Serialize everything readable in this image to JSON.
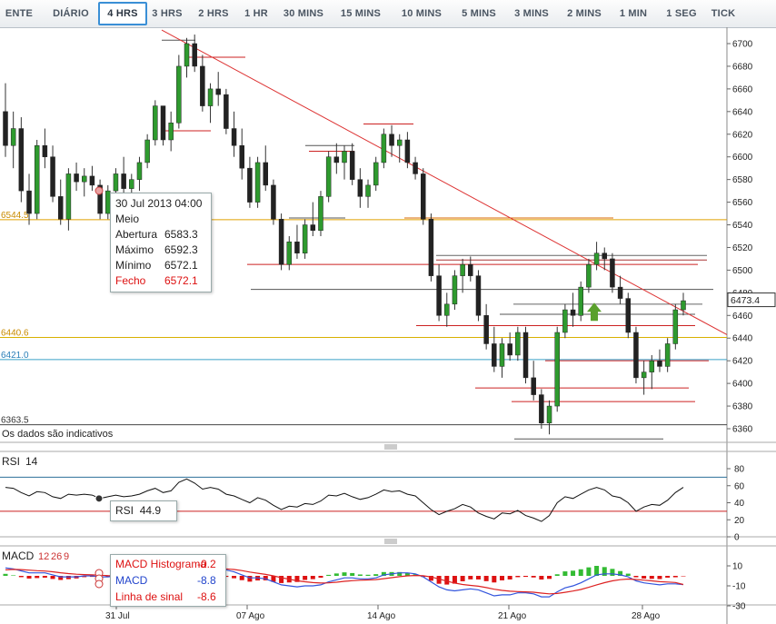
{
  "timeframes": [
    "ENTE",
    "DIÁRIO",
    "4 HRS",
    "3 HRS",
    "2 HRS",
    "1 HR",
    "30 MINS",
    "15 MINS",
    "10 MINS",
    "5 MINS",
    "3 MINS",
    "2 MINS",
    "1 MIN",
    "1 SEG",
    "TICK"
  ],
  "active_timeframe": "4 HRS",
  "disclaimer": "Os dados são indicativos",
  "price_axis": {
    "ticks": [
      6700,
      6680,
      6660,
      6640,
      6620,
      6600,
      6580,
      6560,
      6540,
      6520,
      6500,
      6480,
      6460,
      6440,
      6420,
      6400,
      6380,
      6360
    ],
    "current_price": "6473.4"
  },
  "level_labels": [
    {
      "text": "6544.5",
      "value": 6544.5,
      "color": "#c98b00"
    },
    {
      "text": "6440.6",
      "value": 6440.6,
      "color": "#c98b00"
    },
    {
      "text": "6421.0",
      "value": 6421.0,
      "color": "#2a7fb8"
    },
    {
      "text": "6363.5",
      "value": 6363.5,
      "color": "#333333"
    }
  ],
  "x_labels": [
    "31 Jul",
    "07 Ago",
    "14 Ago",
    "21 Ago",
    "28 Ago"
  ],
  "tooltip": {
    "date": "30 Jul 2013 04:00",
    "sub": "Meio",
    "rows": [
      {
        "label": "Abertura",
        "value": "6583.3"
      },
      {
        "label": "Máximo",
        "value": "6592.3"
      },
      {
        "label": "Mínimo",
        "value": "6572.1"
      },
      {
        "label": "Fecho",
        "value": "6572.1"
      }
    ]
  },
  "rsi": {
    "title": "RSI",
    "period": "14",
    "label": "RSI",
    "value": "44.9",
    "ticks": [
      80,
      60,
      40,
      20,
      0
    ]
  },
  "macd": {
    "title": "MACD",
    "params": [
      "12",
      "26",
      "9"
    ],
    "ticks": [
      10,
      -10,
      -30
    ],
    "rows": [
      {
        "label": "MACD Histograma",
        "value": "-0.2"
      },
      {
        "label": "MACD",
        "value": "-8.8"
      },
      {
        "label": "Linha de sinal",
        "value": "-8.6"
      }
    ]
  },
  "colors": {
    "up": "#2e9a2e",
    "down": "#222222",
    "resistance": "#cc2222",
    "trend": "#d33",
    "orange": "#e0a000",
    "cyan": "#3aa0c8",
    "macd": "#3355dd",
    "signal": "#dd2222",
    "hist_up": "#33bb33",
    "hist_down": "#dd1111",
    "accent": "#3a8fd6"
  },
  "chart_data": {
    "type": "candlestick",
    "title": "",
    "xlabel": "",
    "ylabel": "",
    "ylim": [
      6350,
      6710
    ],
    "x_ticks": [
      "31 Jul",
      "07 Ago",
      "14 Ago",
      "21 Ago",
      "28 Ago"
    ],
    "candles": [
      [
        6640,
        6665,
        6600,
        6610
      ],
      [
        6610,
        6640,
        6590,
        6625
      ],
      [
        6625,
        6635,
        6560,
        6570
      ],
      [
        6570,
        6585,
        6540,
        6550
      ],
      [
        6550,
        6615,
        6545,
        6610
      ],
      [
        6610,
        6625,
        6590,
        6600
      ],
      [
        6600,
        6610,
        6560,
        6565
      ],
      [
        6565,
        6580,
        6540,
        6545
      ],
      [
        6545,
        6590,
        6535,
        6585
      ],
      [
        6585,
        6595,
        6570,
        6578
      ],
      [
        6578,
        6590,
        6565,
        6583
      ],
      [
        6583,
        6592,
        6570,
        6575
      ],
      [
        6575,
        6580,
        6545,
        6550
      ],
      [
        6550,
        6575,
        6545,
        6570
      ],
      [
        6570,
        6590,
        6560,
        6585
      ],
      [
        6585,
        6600,
        6560,
        6572
      ],
      [
        6572,
        6585,
        6565,
        6580
      ],
      [
        6580,
        6600,
        6570,
        6595
      ],
      [
        6595,
        6620,
        6590,
        6615
      ],
      [
        6615,
        6650,
        6610,
        6645
      ],
      [
        6645,
        6645,
        6610,
        6615
      ],
      [
        6615,
        6640,
        6605,
        6630
      ],
      [
        6630,
        6690,
        6625,
        6680
      ],
      [
        6680,
        6705,
        6670,
        6700
      ],
      [
        6700,
        6708,
        6675,
        6680
      ],
      [
        6680,
        6690,
        6640,
        6645
      ],
      [
        6645,
        6665,
        6630,
        6660
      ],
      [
        6660,
        6675,
        6645,
        6655
      ],
      [
        6655,
        6660,
        6620,
        6625
      ],
      [
        6625,
        6640,
        6600,
        6610
      ],
      [
        6610,
        6625,
        6580,
        6590
      ],
      [
        6590,
        6600,
        6555,
        6560
      ],
      [
        6560,
        6600,
        6555,
        6595
      ],
      [
        6595,
        6610,
        6570,
        6575
      ],
      [
        6575,
        6580,
        6540,
        6545
      ],
      [
        6545,
        6550,
        6500,
        6505
      ],
      [
        6505,
        6530,
        6500,
        6525
      ],
      [
        6525,
        6540,
        6510,
        6515
      ],
      [
        6515,
        6545,
        6510,
        6540
      ],
      [
        6540,
        6560,
        6530,
        6535
      ],
      [
        6535,
        6570,
        6530,
        6565
      ],
      [
        6565,
        6605,
        6560,
        6600
      ],
      [
        6600,
        6612,
        6585,
        6595
      ],
      [
        6595,
        6610,
        6580,
        6605
      ],
      [
        6605,
        6612,
        6575,
        6580
      ],
      [
        6580,
        6590,
        6555,
        6565
      ],
      [
        6565,
        6580,
        6555,
        6575
      ],
      [
        6575,
        6600,
        6570,
        6595
      ],
      [
        6595,
        6625,
        6590,
        6620
      ],
      [
        6620,
        6628,
        6600,
        6610
      ],
      [
        6610,
        6620,
        6595,
        6615
      ],
      [
        6615,
        6622,
        6590,
        6595
      ],
      [
        6595,
        6600,
        6580,
        6585
      ],
      [
        6585,
        6590,
        6540,
        6545
      ],
      [
        6545,
        6550,
        6490,
        6495
      ],
      [
        6495,
        6505,
        6455,
        6460
      ],
      [
        6460,
        6480,
        6450,
        6470
      ],
      [
        6470,
        6500,
        6465,
        6495
      ],
      [
        6495,
        6510,
        6480,
        6505
      ],
      [
        6505,
        6512,
        6490,
        6495
      ],
      [
        6495,
        6500,
        6455,
        6460
      ],
      [
        6460,
        6470,
        6430,
        6435
      ],
      [
        6435,
        6450,
        6410,
        6415
      ],
      [
        6415,
        6440,
        6405,
        6435
      ],
      [
        6435,
        6445,
        6420,
        6425
      ],
      [
        6425,
        6450,
        6420,
        6445
      ],
      [
        6445,
        6450,
        6400,
        6405
      ],
      [
        6405,
        6420,
        6385,
        6390
      ],
      [
        6390,
        6395,
        6360,
        6365
      ],
      [
        6365,
        6385,
        6355,
        6380
      ],
      [
        6380,
        6450,
        6375,
        6445
      ],
      [
        6445,
        6470,
        6440,
        6465
      ],
      [
        6465,
        6480,
        6450,
        6460
      ],
      [
        6460,
        6490,
        6455,
        6485
      ],
      [
        6485,
        6510,
        6480,
        6505
      ],
      [
        6505,
        6525,
        6500,
        6515
      ],
      [
        6515,
        6520,
        6500,
        6510
      ],
      [
        6510,
        6515,
        6480,
        6485
      ],
      [
        6485,
        6495,
        6470,
        6475
      ],
      [
        6475,
        6480,
        6440,
        6445
      ],
      [
        6445,
        6450,
        6400,
        6405
      ],
      [
        6405,
        6420,
        6390,
        6410
      ],
      [
        6410,
        6425,
        6395,
        6420
      ],
      [
        6420,
        6430,
        6410,
        6415
      ],
      [
        6415,
        6440,
        6410,
        6435
      ],
      [
        6435,
        6470,
        6430,
        6465
      ],
      [
        6465,
        6480,
        6460,
        6473
      ]
    ],
    "rsi": [
      58,
      57,
      52,
      48,
      53,
      52,
      47,
      45,
      50,
      49,
      50,
      49,
      45,
      47,
      49,
      47,
      48,
      50,
      54,
      57,
      52,
      54,
      64,
      68,
      63,
      56,
      58,
      56,
      50,
      48,
      44,
      40,
      46,
      43,
      37,
      32,
      36,
      35,
      39,
      38,
      42,
      49,
      48,
      51,
      47,
      44,
      46,
      50,
      55,
      53,
      54,
      50,
      48,
      40,
      32,
      26,
      30,
      33,
      38,
      35,
      28,
      24,
      21,
      28,
      27,
      31,
      25,
      22,
      18,
      25,
      40,
      47,
      45,
      50,
      55,
      58,
      55,
      48,
      46,
      40,
      30,
      35,
      38,
      37,
      43,
      52,
      58
    ],
    "macd": [
      8,
      7,
      5,
      3,
      3,
      3,
      1,
      -1,
      -1,
      -1,
      0,
      0,
      -1,
      -1,
      0,
      0,
      0,
      1,
      2,
      4,
      3,
      4,
      7,
      10,
      11,
      10,
      9,
      8,
      6,
      4,
      1,
      -2,
      -2,
      -3,
      -6,
      -9,
      -10,
      -11,
      -10,
      -10,
      -9,
      -6,
      -4,
      -2,
      -2,
      -3,
      -3,
      -2,
      1,
      2,
      3,
      3,
      2,
      -1,
      -6,
      -11,
      -14,
      -15,
      -14,
      -13,
      -14,
      -17,
      -20,
      -19,
      -19,
      -17,
      -17,
      -18,
      -21,
      -21,
      -16,
      -12,
      -10,
      -7,
      -3,
      1,
      2,
      2,
      1,
      -1,
      -5,
      -7,
      -8,
      -9,
      -8,
      -8,
      -8.8
    ],
    "signal": [
      6,
      6.5,
      6.3,
      5.7,
      5.2,
      4.8,
      4.1,
      3.1,
      2.3,
      1.6,
      1.3,
      1,
      0.6,
      0.3,
      0.2,
      0.2,
      0.2,
      0.4,
      0.7,
      1.4,
      1.7,
      2.2,
      3.2,
      4.5,
      5.8,
      6.6,
      7.1,
      7.3,
      7,
      6.4,
      5.3,
      3.8,
      2.6,
      1.5,
      0,
      -1.8,
      -3.4,
      -4.9,
      -5.9,
      -6.7,
      -7.2,
      -7,
      -6.4,
      -5.5,
      -4.8,
      -4.4,
      -4.1,
      -3.7,
      -2.8,
      -1.8,
      -0.8,
      0,
      0.4,
      0.1,
      -1.1,
      -3.1,
      -5.3,
      -7.2,
      -8.6,
      -9.5,
      -10.4,
      -11.7,
      -13.4,
      -14.5,
      -15.4,
      -15.7,
      -16,
      -16.4,
      -17.3,
      -18,
      -17.6,
      -16.5,
      -15.2,
      -13.6,
      -11.5,
      -9,
      -6.8,
      -5,
      -3.8,
      -3.2,
      -3.6,
      -4.3,
      -5,
      -5.8,
      -6.2,
      -6.6,
      -8.6
    ],
    "trendline": {
      "from": {
        "idx": 21,
        "price": 6712
      },
      "to": {
        "idx": 87,
        "price": 6450
      }
    },
    "horizontal_levels": [
      6544.5,
      6505,
      6482,
      6440.6,
      6421,
      6396,
      6363.5
    ],
    "annotation": {
      "idx": 81,
      "price": 6460,
      "type": "up-arrow"
    }
  }
}
